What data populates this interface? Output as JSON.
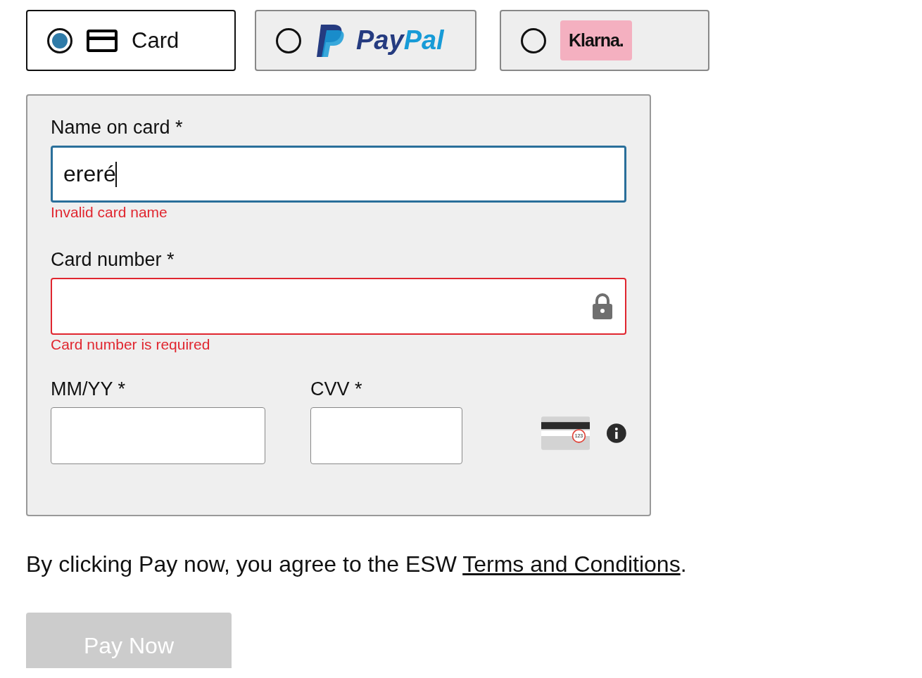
{
  "payment_methods": [
    {
      "kind": "card",
      "label": "Card",
      "selected": true
    },
    {
      "kind": "paypal",
      "label": "PayPal",
      "selected": false
    },
    {
      "kind": "klarna",
      "label": "Klarna.",
      "selected": false
    }
  ],
  "form": {
    "fields": [
      {
        "kind": "name",
        "label": "Name on card *",
        "value": "ereré",
        "focused": true,
        "error": "Invalid card name"
      },
      {
        "kind": "number",
        "label": "Card number *",
        "focused": false,
        "error": "Card number is required"
      }
    ],
    "expiry": {
      "label": "MM/YY *"
    },
    "cvv": {
      "label": "CVV *",
      "hint": "123"
    }
  },
  "consent": {
    "text": "By clicking Pay now, you agree to the ESW ",
    "link": "Terms and Conditions",
    "end": "."
  },
  "pay_button": {
    "label": "Pay Now",
    "disabled": true
  }
}
